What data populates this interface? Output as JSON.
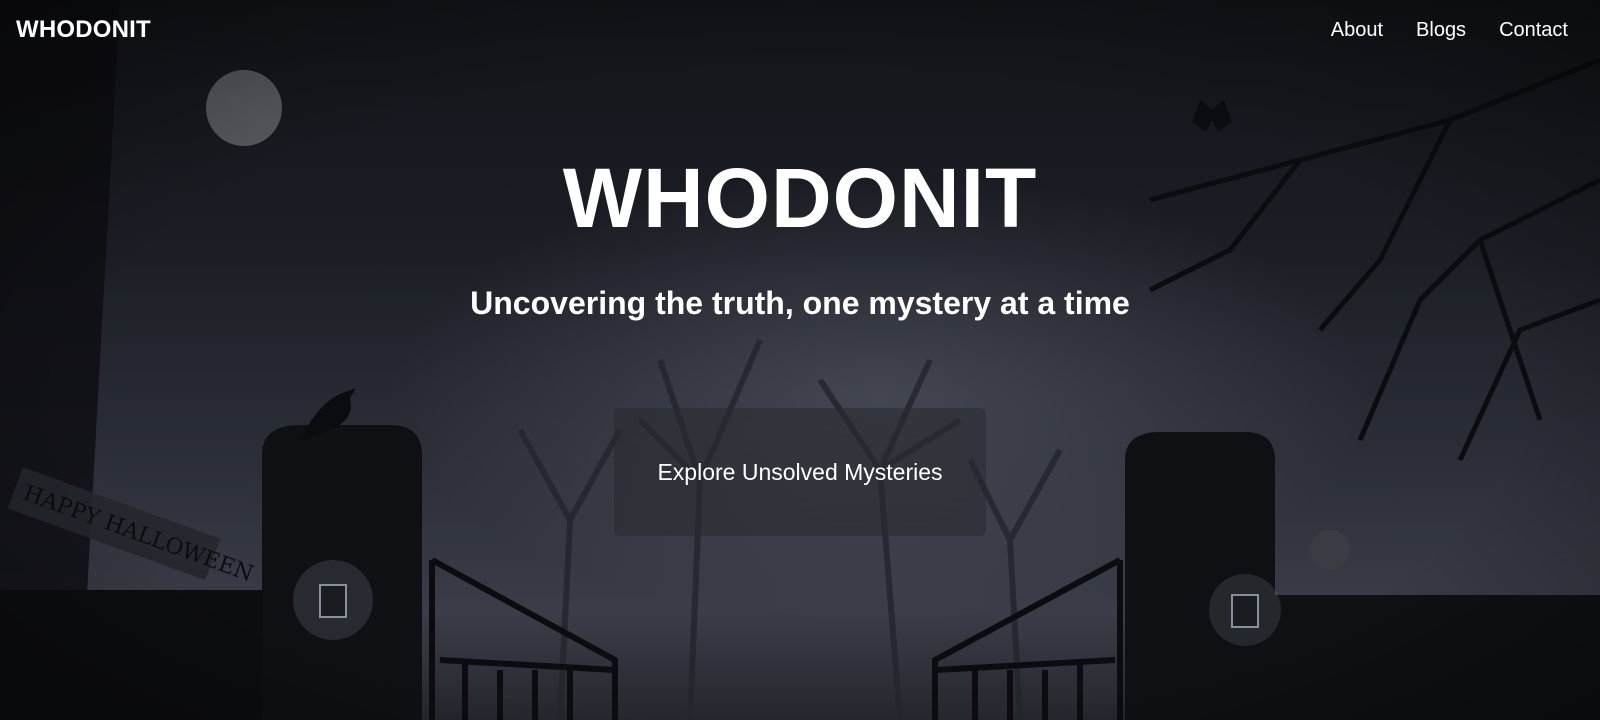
{
  "header": {
    "brand": "WHODONIT",
    "nav": [
      {
        "label": "About"
      },
      {
        "label": "Blogs"
      },
      {
        "label": "Contact"
      }
    ]
  },
  "hero": {
    "title": "WHODONIT",
    "tagline": "Uncovering the truth, one mystery at a time",
    "cta_label": "Explore Unsolved Mysteries"
  },
  "background": {
    "sign_text": "HAPPY HALLOWEEN",
    "theme_colors": {
      "sky": "#15171c",
      "fog": "#3a3d47",
      "silhouette": "#0b0c10"
    }
  }
}
